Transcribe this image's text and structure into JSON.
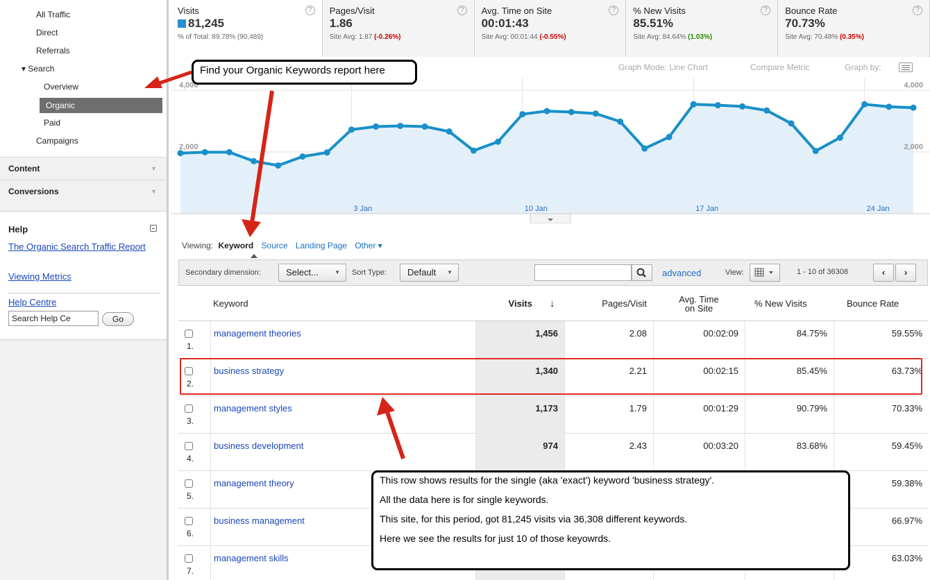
{
  "sidebar": {
    "traffic_items": [
      {
        "label": "All Traffic"
      },
      {
        "label": "Direct"
      },
      {
        "label": "Referrals"
      }
    ],
    "search_group": {
      "label": "▾ Search"
    },
    "search_items": [
      {
        "label": "Overview"
      },
      {
        "label": "Organic"
      },
      {
        "label": "Paid"
      }
    ],
    "campaigns": {
      "label": "Campaigns"
    },
    "sections": [
      {
        "label": "Content"
      },
      {
        "label": "Conversions"
      }
    ],
    "help": {
      "title": "Help",
      "links": [
        "The Organic Search Traffic Report",
        "Viewing Metrics"
      ],
      "help_centre": "Help Centre",
      "search_value": "Search Help Ce",
      "go_label": "Go"
    }
  },
  "scorecards": [
    {
      "label": "Visits",
      "value": "81,245",
      "sub": "% of Total: 89.78% (90,489)",
      "delta": ""
    },
    {
      "label": "Pages/Visit",
      "value": "1.86",
      "sub": "Site Avg: 1.87 ",
      "delta": "(-0.26%)",
      "delta_sign": "neg"
    },
    {
      "label": "Avg. Time on Site",
      "value": "00:01:43",
      "sub": "Site Avg: 00:01:44 ",
      "delta": "(-0.55%)",
      "delta_sign": "neg"
    },
    {
      "label": "% New Visits",
      "value": "85.51%",
      "sub": "Site Avg: 84.64% ",
      "delta": "(1.03%)",
      "delta_sign": "pos"
    },
    {
      "label": "Bounce Rate",
      "value": "70.73%",
      "sub": "Site Avg: 70.48% ",
      "delta": "(0.35%)",
      "delta_sign": "neg"
    }
  ],
  "graph_controls": {
    "graph_mode": "Graph Mode:  Line Chart",
    "compare": "Compare Metric",
    "graph_by": "Graph by:"
  },
  "chart_data": {
    "type": "area",
    "series": [
      {
        "values": [
          1960,
          1990,
          1990,
          1700,
          1560,
          1850,
          1980,
          2720,
          2820,
          2840,
          2820,
          2660,
          2040,
          2330,
          3220,
          3320,
          3290,
          3240,
          2980,
          2110,
          2480,
          3540,
          3510,
          3470,
          3340,
          2920,
          2030,
          2460,
          3540,
          3460,
          3430
        ]
      }
    ],
    "x_tick_labels": [
      {
        "index": 7,
        "label": "3 Jan"
      },
      {
        "index": 14,
        "label": "10 Jan"
      },
      {
        "index": 21,
        "label": "17 Jan"
      },
      {
        "index": 28,
        "label": "24 Jan"
      }
    ],
    "y_tick_labels": [
      {
        "value": 2000,
        "label": "2,000"
      },
      {
        "value": 4000,
        "label": "4,000"
      }
    ],
    "ylim": [
      0,
      4400
    ],
    "color": "#1990c8",
    "fill": "#e4f0f9"
  },
  "viewing": {
    "label": "Viewing:",
    "active": "Keyword",
    "others": [
      "Source",
      "Landing Page",
      "Other ▾"
    ]
  },
  "toolbar": {
    "secondary_label": "Secondary dimension:",
    "secondary_value": "Select...",
    "sort_label": "Sort Type:",
    "sort_value": "Default",
    "search_value": "",
    "advanced": "advanced",
    "view_label": "View:",
    "range": "1 - 10 of 36308"
  },
  "table": {
    "headers": {
      "keyword": "Keyword",
      "visits": "Visits",
      "pages_visit": "Pages/Visit",
      "avg_time": "Avg. Time on Site",
      "new_visits": "% New Visits",
      "bounce": "Bounce Rate"
    },
    "rows": [
      {
        "num": "1.",
        "keyword": "management theories",
        "visits": "1,456",
        "pv": "2.08",
        "ats": "00:02:09",
        "nv": "84.75%",
        "br": "59.55%"
      },
      {
        "num": "2.",
        "keyword": "business strategy",
        "visits": "1,340",
        "pv": "2.21",
        "ats": "00:02:15",
        "nv": "85.45%",
        "br": "63.73%"
      },
      {
        "num": "3.",
        "keyword": "management styles",
        "visits": "1,173",
        "pv": "1.79",
        "ats": "00:01:29",
        "nv": "90.79%",
        "br": "70.33%"
      },
      {
        "num": "4.",
        "keyword": "business development",
        "visits": "974",
        "pv": "2.43",
        "ats": "00:03:20",
        "nv": "83.68%",
        "br": "59.45%"
      },
      {
        "num": "5.",
        "keyword": "management theory",
        "visits": "",
        "pv": "",
        "ats": "",
        "nv": "",
        "br": "59.38%"
      },
      {
        "num": "6.",
        "keyword": "business management",
        "visits": "",
        "pv": "",
        "ats": "",
        "nv": "",
        "br": "66.97%"
      },
      {
        "num": "7.",
        "keyword": "management skills",
        "visits": "",
        "pv": "",
        "ats": "",
        "nv": "",
        "br": "63.03%"
      }
    ]
  },
  "annotations": {
    "callout_top": "Find your Organic Keywords report here",
    "callout_bottom": [
      "This row shows results for the single (aka 'exact') keyword 'business strategy'.",
      "All the data here is for single keywords.",
      "This site, for this period, got 81,245 visits via 36,308 different keywords.",
      "Here we see the results for just 10 of those keyowrds."
    ]
  }
}
